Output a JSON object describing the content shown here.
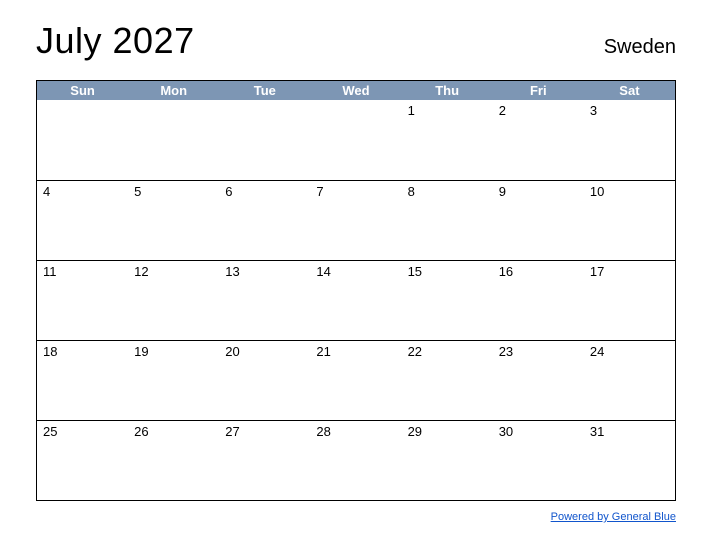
{
  "header": {
    "title": "July 2027",
    "country": "Sweden"
  },
  "weekdays": [
    "Sun",
    "Mon",
    "Tue",
    "Wed",
    "Thu",
    "Fri",
    "Sat"
  ],
  "weeks": [
    [
      "",
      "",
      "",
      "",
      "1",
      "2",
      "3"
    ],
    [
      "4",
      "5",
      "6",
      "7",
      "8",
      "9",
      "10"
    ],
    [
      "11",
      "12",
      "13",
      "14",
      "15",
      "16",
      "17"
    ],
    [
      "18",
      "19",
      "20",
      "21",
      "22",
      "23",
      "24"
    ],
    [
      "25",
      "26",
      "27",
      "28",
      "29",
      "30",
      "31"
    ]
  ],
  "footer": {
    "link_text": "Powered by General Blue"
  }
}
